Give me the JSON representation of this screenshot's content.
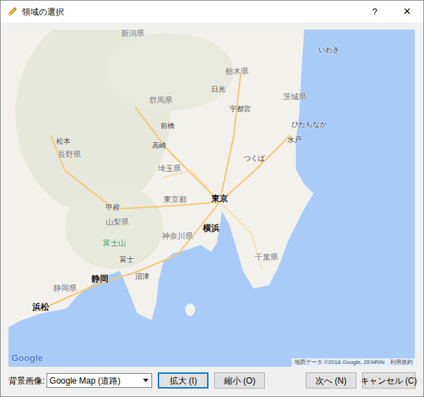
{
  "window": {
    "title": "領域の選択",
    "help": "?",
    "close": "×"
  },
  "map": {
    "places": [
      {
        "name": "新潟県",
        "kind": "region"
      },
      {
        "name": "いわき",
        "kind": "city"
      },
      {
        "name": "栃木県",
        "kind": "region"
      },
      {
        "name": "日光",
        "kind": "city"
      },
      {
        "name": "茨城県",
        "kind": "region"
      },
      {
        "name": "群馬県",
        "kind": "region"
      },
      {
        "name": "宇都宮",
        "kind": "city"
      },
      {
        "name": "ひたちなか",
        "kind": "city"
      },
      {
        "name": "前橋",
        "kind": "city"
      },
      {
        "name": "水戸",
        "kind": "city"
      },
      {
        "name": "高崎",
        "kind": "city"
      },
      {
        "name": "松本",
        "kind": "city"
      },
      {
        "name": "長野県",
        "kind": "region"
      },
      {
        "name": "つくば",
        "kind": "city"
      },
      {
        "name": "埼玉県",
        "kind": "region"
      },
      {
        "name": "東京都",
        "kind": "region"
      },
      {
        "name": "東京",
        "kind": "capital"
      },
      {
        "name": "甲府",
        "kind": "city"
      },
      {
        "name": "山梨県",
        "kind": "region"
      },
      {
        "name": "横浜",
        "kind": "capital"
      },
      {
        "name": "神奈川県",
        "kind": "region"
      },
      {
        "name": "富士山",
        "kind": "landmark"
      },
      {
        "name": "千葉県",
        "kind": "region"
      },
      {
        "name": "富士",
        "kind": "city"
      },
      {
        "name": "沼津",
        "kind": "city"
      },
      {
        "name": "静岡",
        "kind": "capital"
      },
      {
        "name": "静岡県",
        "kind": "region"
      },
      {
        "name": "浜松",
        "kind": "capital"
      }
    ],
    "logo": "Google",
    "attribution": "地図データ ©2018 Google, ZENRIN",
    "terms": "利用規約"
  },
  "controls": {
    "background_label": "背景画像:",
    "background_value": "Google Map (道路)",
    "zoom_buttons": [
      {
        "label": "拡大 (I)",
        "focused": true
      },
      {
        "label": "縮小 (O)",
        "focused": false
      }
    ],
    "dialog_buttons": [
      {
        "label": "次へ (N)",
        "focused": false
      },
      {
        "label": "キャンセル (C)",
        "focused": false
      }
    ]
  }
}
